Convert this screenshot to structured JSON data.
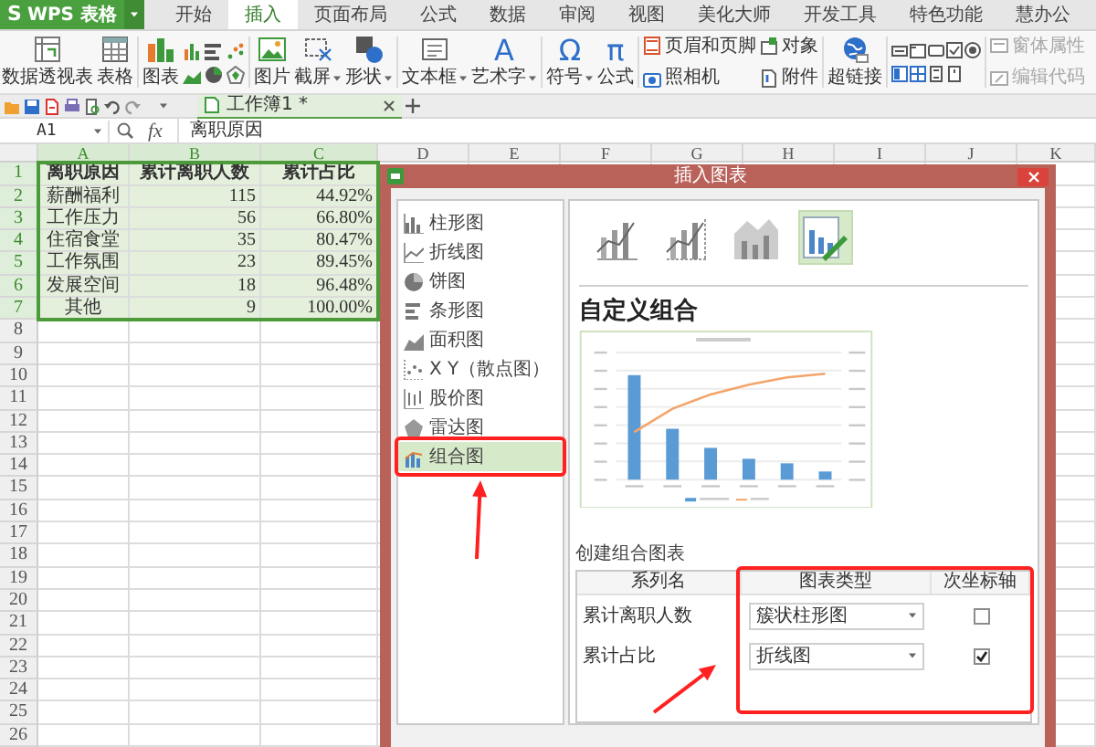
{
  "app_menu": {
    "logo": "S",
    "label": "WPS 表格"
  },
  "menu_tabs": [
    {
      "label": "开始",
      "selected": false
    },
    {
      "label": "插入",
      "selected": true
    },
    {
      "label": "页面布局",
      "selected": false
    },
    {
      "label": "公式",
      "selected": false
    },
    {
      "label": "数据",
      "selected": false
    },
    {
      "label": "审阅",
      "selected": false
    },
    {
      "label": "视图",
      "selected": false
    },
    {
      "label": "美化大师",
      "selected": false
    },
    {
      "label": "开发工具",
      "selected": false
    },
    {
      "label": "特色功能",
      "selected": false
    },
    {
      "label": "慧办公",
      "selected": false
    }
  ],
  "ribbon_groups": [
    {
      "items": [
        {
          "kind": "large",
          "label": "数据透视表"
        },
        {
          "kind": "large",
          "label": "表格"
        }
      ]
    },
    {
      "items": [
        {
          "kind": "large",
          "label": "图表"
        },
        {
          "kind": "chart_grid"
        }
      ]
    },
    {
      "items": [
        {
          "kind": "large",
          "label": "图片"
        },
        {
          "kind": "large",
          "label": "截屏",
          "menu": true
        },
        {
          "kind": "large",
          "label": "形状",
          "menu": true
        }
      ]
    },
    {
      "items": [
        {
          "kind": "large",
          "label": "文本框",
          "menu": true
        },
        {
          "kind": "large",
          "label": "艺术字",
          "glyph": "A",
          "menu": true
        }
      ]
    },
    {
      "items": [
        {
          "kind": "large",
          "label": "符号",
          "glyph": "Ω",
          "menu": true
        },
        {
          "kind": "large",
          "label": "公式",
          "glyph": "π"
        }
      ]
    },
    {
      "items": [
        {
          "kind": "small",
          "label": "页眉和页脚"
        },
        {
          "kind": "small",
          "label": "照相机"
        },
        {
          "kind": "small",
          "label": "对象"
        },
        {
          "kind": "small",
          "label": "附件"
        }
      ]
    },
    {
      "items": [
        {
          "kind": "large",
          "label": "超链接"
        }
      ]
    },
    {
      "items": [
        {
          "kind": "form_grid"
        }
      ]
    },
    {
      "items": [
        {
          "kind": "small",
          "label": "窗体属性",
          "disabled": true
        },
        {
          "kind": "small",
          "label": "编辑代码",
          "disabled": true
        }
      ]
    }
  ],
  "doc_tab": {
    "title": "工作簿1 *"
  },
  "formula_bar": {
    "cell_ref": "A1",
    "function_label": "fx",
    "formula": "离职原因"
  },
  "sheet": {
    "columns": [
      {
        "label": "A",
        "selected": true
      },
      {
        "label": "B",
        "selected": true
      },
      {
        "label": "C",
        "selected": true
      },
      {
        "label": "D",
        "selected": false
      },
      {
        "label": "E",
        "selected": false
      },
      {
        "label": "F",
        "selected": false
      },
      {
        "label": "G",
        "selected": false
      },
      {
        "label": "H",
        "selected": false
      },
      {
        "label": "I",
        "selected": false
      },
      {
        "label": "J",
        "selected": false
      },
      {
        "label": "K",
        "selected": false
      }
    ],
    "rows": [
      {
        "number": "1",
        "selected": true,
        "header": true,
        "cells": [
          "离职原因",
          "累计离职人数",
          "累计占比"
        ]
      },
      {
        "number": "2",
        "selected": true,
        "cells": [
          "薪酬福利",
          "115",
          "44.92%"
        ]
      },
      {
        "number": "3",
        "selected": true,
        "cells": [
          "工作压力",
          "56",
          "66.80%"
        ]
      },
      {
        "number": "4",
        "selected": true,
        "cells": [
          "住宿食堂",
          "35",
          "80.47%"
        ]
      },
      {
        "number": "5",
        "selected": true,
        "cells": [
          "工作氛围",
          "23",
          "89.45%"
        ]
      },
      {
        "number": "6",
        "selected": true,
        "cells": [
          "发展空间",
          "18",
          "96.48%"
        ]
      },
      {
        "number": "7",
        "selected": true,
        "cells": [
          "其他",
          "9",
          "100.00%"
        ]
      },
      {
        "number": "8",
        "selected": false
      },
      {
        "number": "9",
        "selected": false
      },
      {
        "number": "10",
        "selected": false
      },
      {
        "number": "11",
        "selected": false
      },
      {
        "number": "12",
        "selected": false
      },
      {
        "number": "13",
        "selected": false
      },
      {
        "number": "14",
        "selected": false
      },
      {
        "number": "15",
        "selected": false
      },
      {
        "number": "16",
        "selected": false
      },
      {
        "number": "17",
        "selected": false
      },
      {
        "number": "18",
        "selected": false
      },
      {
        "number": "19",
        "selected": false
      },
      {
        "number": "20",
        "selected": false
      },
      {
        "number": "21",
        "selected": false
      },
      {
        "number": "22",
        "selected": false
      },
      {
        "number": "23",
        "selected": false
      },
      {
        "number": "24",
        "selected": false
      },
      {
        "number": "25",
        "selected": false
      },
      {
        "number": "26",
        "selected": false
      }
    ]
  },
  "dialog": {
    "title": "插入图表",
    "chart_types": [
      {
        "label": "柱形图",
        "selected": false
      },
      {
        "label": "折线图",
        "selected": false
      },
      {
        "label": "饼图",
        "selected": false
      },
      {
        "label": "条形图",
        "selected": false
      },
      {
        "label": "面积图",
        "selected": false
      },
      {
        "label": "X Y（散点图）",
        "selected": false
      },
      {
        "label": "股价图",
        "selected": false
      },
      {
        "label": "雷达图",
        "selected": false
      },
      {
        "label": "组合图",
        "selected": true
      }
    ],
    "subtypes": [
      {
        "selected": false
      },
      {
        "selected": false
      },
      {
        "selected": false
      },
      {
        "selected": true
      }
    ],
    "section_title": "自定义组合",
    "combo_label": "创建组合图表",
    "combo_table": {
      "columns": [
        "系列名",
        "图表类型",
        "次坐标轴"
      ],
      "rows": [
        {
          "series": "累计离职人数",
          "chart_type": "簇状柱形图",
          "secondary_axis": false
        },
        {
          "series": "累计占比",
          "chart_type": "折线图",
          "secondary_axis": true
        }
      ]
    }
  }
}
